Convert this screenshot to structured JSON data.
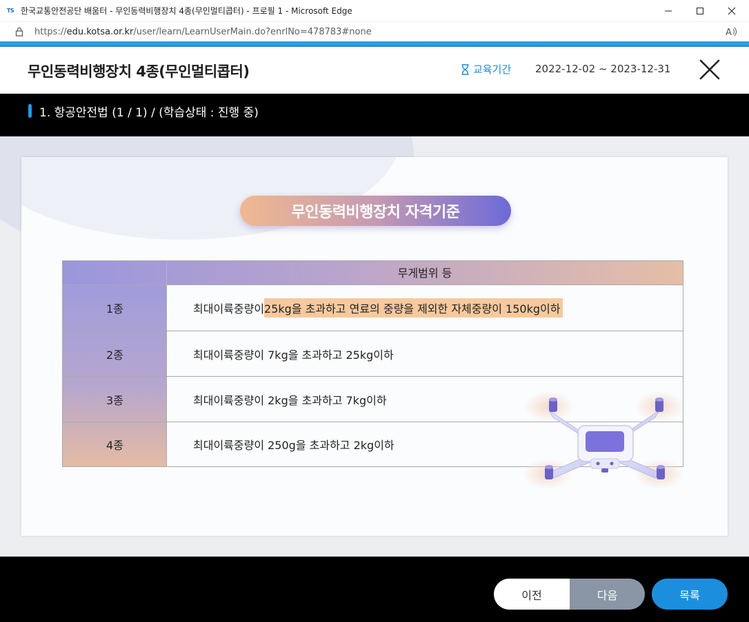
{
  "window": {
    "logo_text": "TS",
    "title": "한국교통안전공단 배움터 - 무인동력비행장치 4종(무인멀티콥터) - 프로필 1 - Microsoft Edge"
  },
  "addressbar": {
    "url_prefix": "https://",
    "url_host": "edu.kotsa.or.kr",
    "url_path": "/user/learn/LearnUserMain.do?enrlNo=478783#none"
  },
  "header": {
    "course_title": "무인동력비행장치 4종(무인멀티콥터)",
    "period_label": "교육기간",
    "period_dates": "2022-12-02 ~ 2023-12-31"
  },
  "chapter": {
    "text": "1. 항공안전법 (1 / 1) / (학습상태 : 진행 중)"
  },
  "slide": {
    "title": "무인동력비행장치 자격기준",
    "table": {
      "header": "무게범위 등",
      "rows": [
        {
          "label": "1종",
          "text_plain": "최대이륙중량이 ",
          "text_highlight": "25kg을 초과하고 연료의 중량을 제외한 자체중량이 150kg이하"
        },
        {
          "label": "2종",
          "text_plain": "최대이륙중량이 7kg을 초과하고 25kg이하",
          "text_highlight": ""
        },
        {
          "label": "3종",
          "text_plain": "최대이륙중량이 2kg을 초과하고 7kg이하",
          "text_highlight": ""
        },
        {
          "label": "4종",
          "text_plain": "최대이륙중량이 250g을 초과하고 2kg이하",
          "text_highlight": ""
        }
      ]
    }
  },
  "footer": {
    "prev_label": "이전",
    "next_label": "다음",
    "list_label": "목록"
  },
  "colors": {
    "accent_blue": "#1b8fde",
    "highlight": "#f7c99c",
    "next_button": "#8a96a5"
  }
}
